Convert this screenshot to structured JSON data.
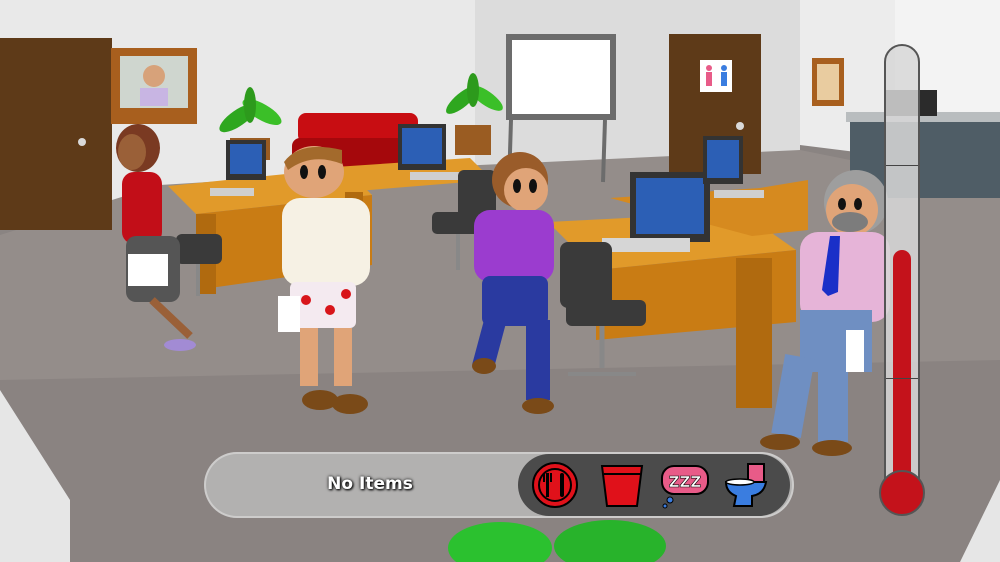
{
  "hud": {
    "inventory_label": "No Items",
    "needs": [
      {
        "name": "food",
        "icon": "fork-knife-icon",
        "color": "#e0111a"
      },
      {
        "name": "drink",
        "icon": "cup-icon",
        "color": "#e0111a"
      },
      {
        "name": "sleep",
        "icon": "zzz-bubble-icon",
        "color": "#e85b88"
      },
      {
        "name": "toilet",
        "icon": "toilet-icon",
        "color": "#3a7de0"
      }
    ]
  },
  "meter": {
    "level": 0.55,
    "fill_color": "#c4121b"
  },
  "scene": {
    "restroom_sign": "restroom-sign-icon"
  }
}
